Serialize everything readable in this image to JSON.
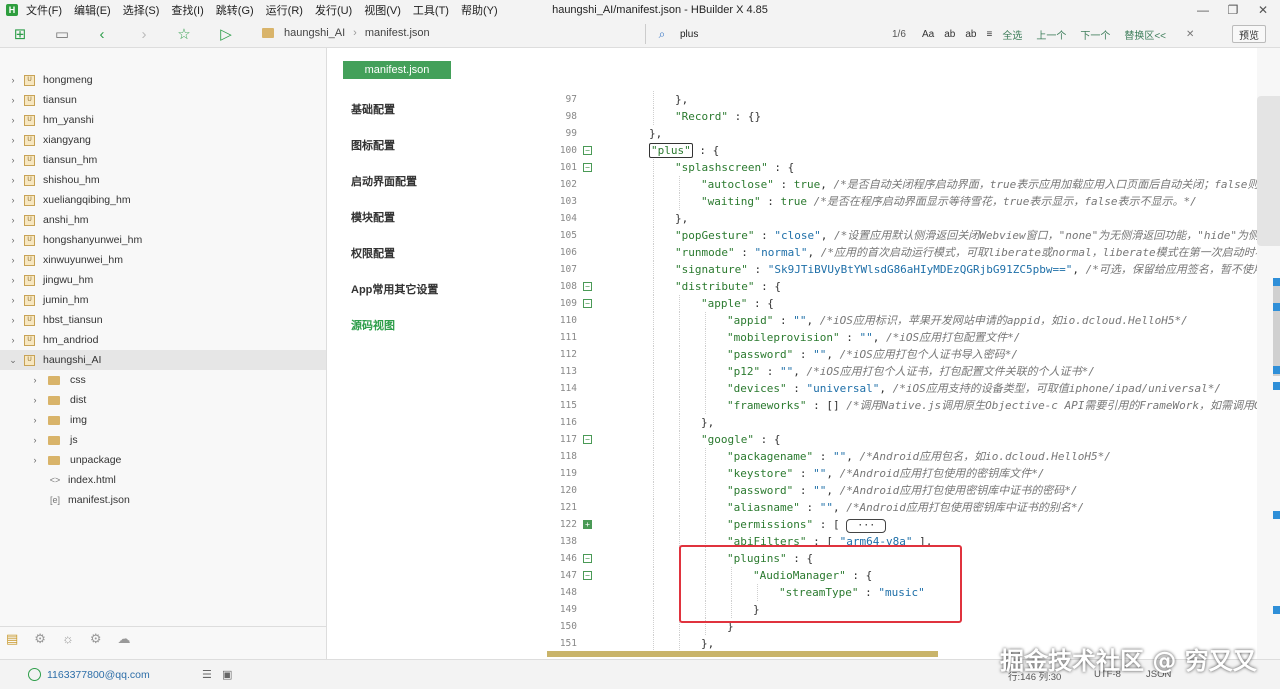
{
  "menubar": {
    "items": [
      "文件(F)",
      "编辑(E)",
      "选择(S)",
      "查找(I)",
      "跳转(G)",
      "运行(R)",
      "发行(U)",
      "视图(V)",
      "工具(T)",
      "帮助(Y)"
    ],
    "window_title": "haungshi_AI/manifest.json - HBuilder X 4.85"
  },
  "toolbar": {
    "breadcrumb": [
      "haungshi_AI",
      "manifest.json"
    ],
    "search": {
      "query": "plus",
      "match_count": "1/6",
      "options": [
        "Aa",
        "ab",
        "ab"
      ],
      "select_all": "全选",
      "prev": "上一个",
      "next": "下一个",
      "replace": "替换区<<"
    },
    "preview_label": "预览"
  },
  "sidebar": {
    "projects": [
      "hongmeng",
      "tiansun",
      "hm_yanshi",
      "xiangyang",
      "tiansun_hm",
      "shishou_hm",
      "xueliangqibing_hm",
      "anshi_hm",
      "hongshanyunwei_hm",
      "xinwuyunwei_hm",
      "jingwu_hm",
      "jumin_hm",
      "hbst_tiansun",
      "hm_andriod",
      "haungshi_AI"
    ],
    "folders": [
      "css",
      "dist",
      "img",
      "js",
      "unpackage"
    ],
    "files": [
      "index.html",
      "manifest.json"
    ]
  },
  "settings": {
    "file_tab": "manifest.json",
    "nav": [
      "基础配置",
      "图标配置",
      "启动界面配置",
      "模块配置",
      "权限配置",
      "App常用其它设置",
      "源码视图"
    ],
    "active_nav": "源码视图"
  },
  "editor": {
    "lines": [
      {
        "n": "97",
        "text": "},"
      },
      {
        "n": "98",
        "text": "\"Record\" : {}"
      },
      {
        "n": "99",
        "text": "},"
      },
      {
        "n": "100",
        "text": "\"plus\" : {"
      },
      {
        "n": "101",
        "text": "\"splashscreen\" : {"
      },
      {
        "n": "102",
        "text": "\"autoclose\" : true, /*是否自动关闭程序启动界面，true表示应用加载应用入口页面后自动关闭；false则"
      },
      {
        "n": "103",
        "text": "\"waiting\" : true /*是否在程序启动界面显示等待雪花，true表示显示，false表示不显示。*/"
      },
      {
        "n": "104",
        "text": "},"
      },
      {
        "n": "105",
        "text": "\"popGesture\" : \"close\", /*设置应用默认侧滑返回关闭Webview窗口，\"none\"为无侧滑返回功能，\"hide\"为侧"
      },
      {
        "n": "106",
        "text": "\"runmode\" : \"normal\", /*应用的首次启动运行模式，可取liberate或normal，liberate模式在第一次启动时将"
      },
      {
        "n": "107",
        "text": "\"signature\" : \"Sk9JTiBVUyBtYWlsdG86aHIyMDEzQGRjbG91ZC5pbw==\", /*可选，保留给应用签名，暂不使用*/"
      },
      {
        "n": "108",
        "text": "\"distribute\" : {"
      },
      {
        "n": "109",
        "text": "\"apple\" : {"
      },
      {
        "n": "110",
        "text": "\"appid\" : \"\", /*iOS应用标识，苹果开发网站申请的appid，如io.dcloud.HelloH5*/"
      },
      {
        "n": "111",
        "text": "\"mobileprovision\" : \"\", /*iOS应用打包配置文件*/"
      },
      {
        "n": "112",
        "text": "\"password\" : \"\", /*iOS应用打包个人证书导入密码*/"
      },
      {
        "n": "113",
        "text": "\"p12\" : \"\", /*iOS应用打包个人证书，打包配置文件关联的个人证书*/"
      },
      {
        "n": "114",
        "text": "\"devices\" : \"universal\", /*iOS应用支持的设备类型，可取值iphone/ipad/universal*/"
      },
      {
        "n": "115",
        "text": "\"frameworks\" : [] /*调用Native.js调用原生Objective-c API需要引用的FrameWork，如需调用GameC"
      },
      {
        "n": "116",
        "text": "},"
      },
      {
        "n": "117",
        "text": "\"google\" : {"
      },
      {
        "n": "118",
        "text": "\"packagename\" : \"\", /*Android应用包名，如io.dcloud.HelloH5*/"
      },
      {
        "n": "119",
        "text": "\"keystore\" : \"\", /*Android应用打包使用的密钥库文件*/"
      },
      {
        "n": "120",
        "text": "\"password\" : \"\", /*Android应用打包使用密钥库中证书的密码*/"
      },
      {
        "n": "121",
        "text": "\"aliasname\" : \"\", /*Android应用打包使用密钥库中证书的别名*/"
      },
      {
        "n": "122",
        "text": "\"permissions\" : [ ··· "
      },
      {
        "n": "138",
        "text": "\"abiFilters\" : [ \"arm64-v8a\" ],"
      },
      {
        "n": "146",
        "text": "\"plugins\" : {"
      },
      {
        "n": "147",
        "text": "\"AudioManager\" : {"
      },
      {
        "n": "148",
        "text": "\"streamType\" : \"music\""
      },
      {
        "n": "149",
        "text": "}"
      },
      {
        "n": "150",
        "text": "}"
      },
      {
        "n": "151",
        "text": "},"
      }
    ]
  },
  "statusbar": {
    "account": "1163377800@qq.com",
    "position": "行:146   列:30",
    "encoding": "UTF-8",
    "language": "JSON"
  },
  "watermark": "掘金技术社区 @ 穷又又"
}
